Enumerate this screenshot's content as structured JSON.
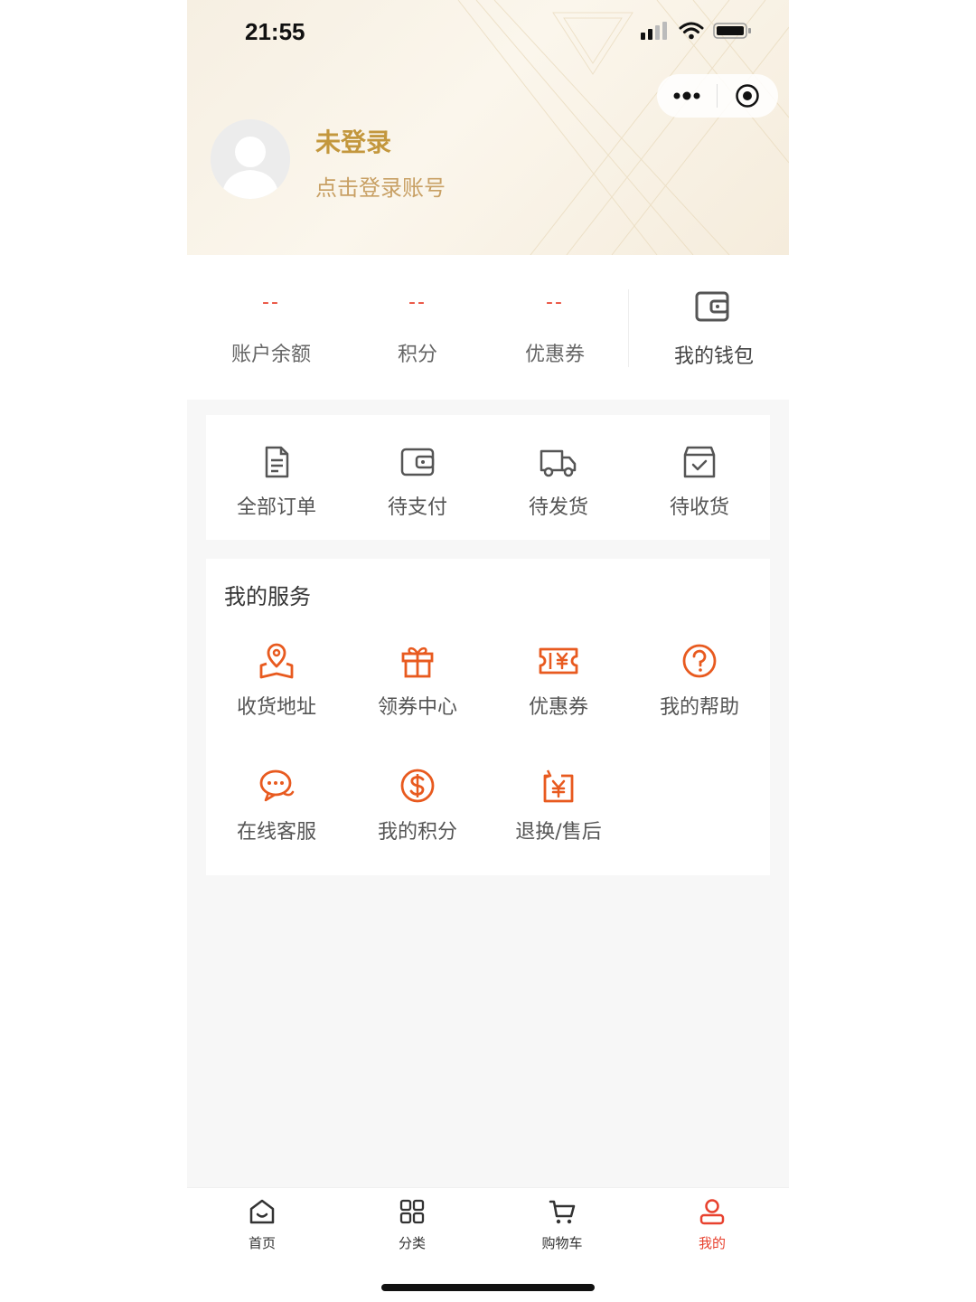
{
  "status_bar": {
    "time": "21:55"
  },
  "user": {
    "name": "未登录",
    "subtitle": "点击登录账号"
  },
  "stats": [
    {
      "value": "--",
      "label": "账户余额"
    },
    {
      "value": "--",
      "label": "积分"
    },
    {
      "value": "--",
      "label": "优惠券"
    }
  ],
  "wallet": {
    "label": "我的钱包",
    "icon": "wallet-icon"
  },
  "orders": [
    {
      "label": "全部订单",
      "icon": "document-icon"
    },
    {
      "label": "待支付",
      "icon": "wallet-icon"
    },
    {
      "label": "待发货",
      "icon": "truck-icon"
    },
    {
      "label": "待收货",
      "icon": "box-check-icon"
    }
  ],
  "services": {
    "title": "我的服务",
    "items": [
      {
        "label": "收货地址",
        "icon": "location-pin-icon"
      },
      {
        "label": "领券中心",
        "icon": "gift-icon"
      },
      {
        "label": "优惠券",
        "icon": "coupon-icon"
      },
      {
        "label": "我的帮助",
        "icon": "help-icon"
      },
      {
        "label": "在线客服",
        "icon": "chat-bubble-icon"
      },
      {
        "label": "我的积分",
        "icon": "dollar-icon"
      },
      {
        "label": "退换/售后",
        "icon": "refund-icon"
      }
    ]
  },
  "tabbar": [
    {
      "label": "首页",
      "icon": "home-icon"
    },
    {
      "label": "分类",
      "icon": "grid-icon"
    },
    {
      "label": "购物车",
      "icon": "cart-icon"
    },
    {
      "label": "我的",
      "icon": "user-icon",
      "active": true
    }
  ],
  "colors": {
    "accent": "#e8412e",
    "gold": "#c3973d",
    "service_icon": "#e85a1f"
  }
}
